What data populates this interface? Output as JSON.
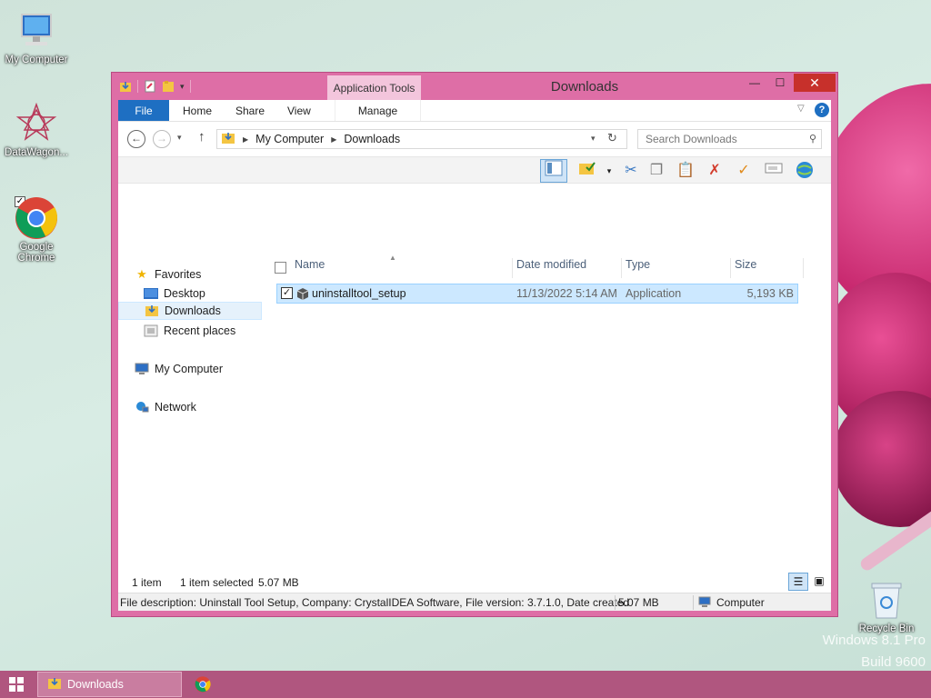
{
  "desktop": {
    "icons": [
      {
        "label": "My Computer"
      },
      {
        "label": "DataWagon..."
      },
      {
        "label": "Google Chrome"
      },
      {
        "label": "Recycle Bin"
      }
    ],
    "watermark": {
      "line1": "Windows 8.1 Pro",
      "line2": "Build 9600"
    }
  },
  "window": {
    "title": "Downloads",
    "context_tab": "Application Tools",
    "close_glyph": "✕",
    "minimize_glyph": "—",
    "maximize_glyph": "☐"
  },
  "ribbon": {
    "tabs": {
      "file": "File",
      "home": "Home",
      "share": "Share",
      "view": "View",
      "manage": "Manage"
    },
    "help": "?"
  },
  "address": {
    "crumbs": [
      "My Computer",
      "Downloads"
    ],
    "search_placeholder": "Search Downloads"
  },
  "nav": {
    "favorites": "Favorites",
    "desktop": "Desktop",
    "downloads": "Downloads",
    "recent": "Recent places",
    "computer": "My Computer",
    "network": "Network"
  },
  "columns": {
    "name": "Name",
    "date": "Date modified",
    "type": "Type",
    "size": "Size"
  },
  "files": [
    {
      "name": "uninstalltool_setup",
      "date": "11/13/2022 5:14 AM",
      "type": "Application",
      "size": "5,193 KB"
    }
  ],
  "status": {
    "count": "1 item",
    "selected": "1 item selected",
    "size": "5.07 MB"
  },
  "details": {
    "description": "File description: Uninstall Tool Setup, Company: CrystalIDEA Software, File version: 3.7.1.0, Date created",
    "size": "5.07 MB",
    "location": "Computer"
  },
  "taskbar": {
    "explorer_label": "Downloads"
  },
  "colors": {
    "window_frame": "#de6ea6",
    "file_tab": "#1e6fc2",
    "selection": "#cce8ff",
    "close": "#c7302b",
    "taskbar": "#b0567f"
  }
}
